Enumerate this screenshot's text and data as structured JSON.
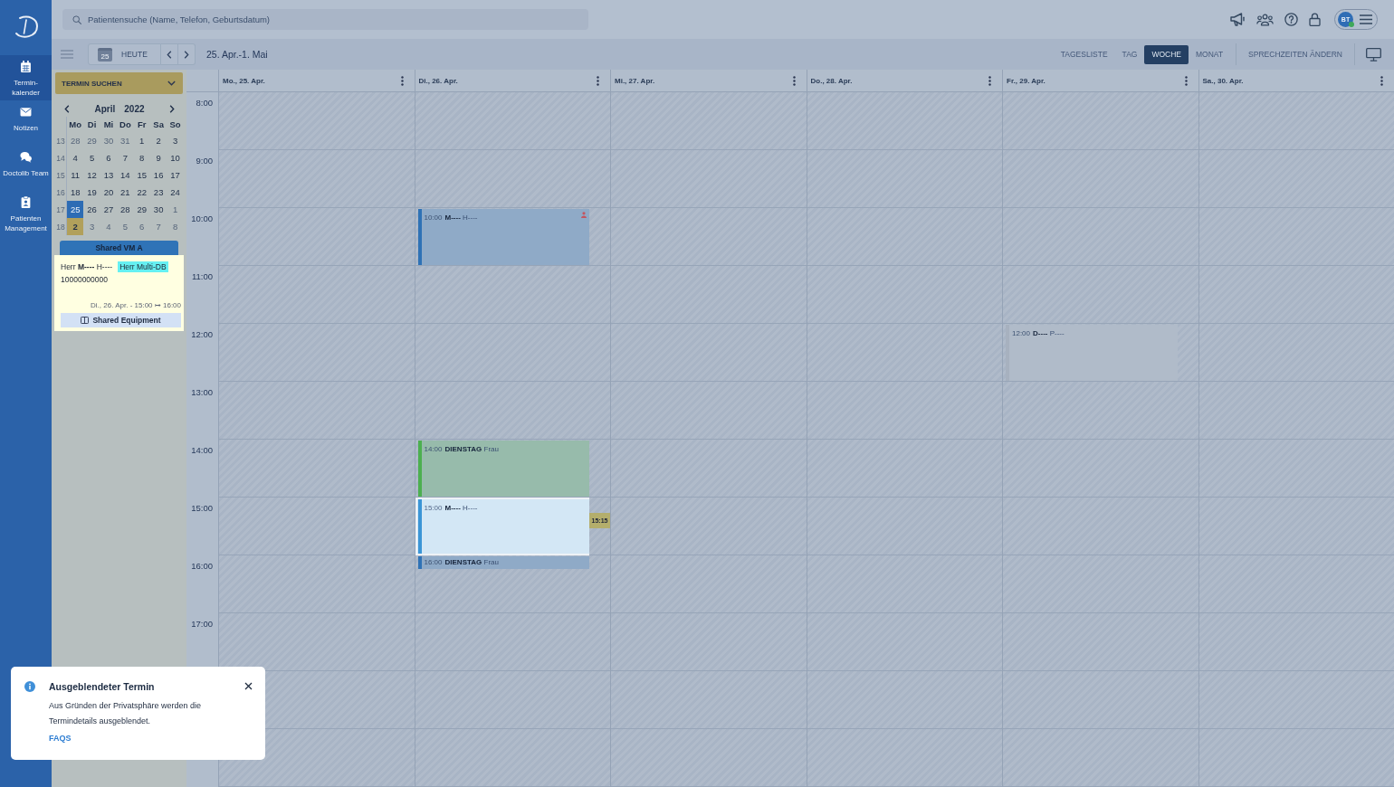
{
  "nav": {
    "items": [
      {
        "label": "Termin-kalender",
        "kind": "calendar",
        "selected": true
      },
      {
        "label": "Notizen",
        "kind": "mail",
        "selected": false
      },
      {
        "label": "Doctolib Team",
        "kind": "chat",
        "selected": false
      },
      {
        "label": "Patienten Management",
        "kind": "clipboard",
        "selected": false
      }
    ]
  },
  "search": {
    "placeholder": "Patientensuche (Name, Telefon, Geburtsdatum)"
  },
  "account": {
    "initials": "BT",
    "online": true
  },
  "toolbar": {
    "today_icon_label": "25",
    "today_button": "HEUTE",
    "date_range": "25. Apr.-1. Mai",
    "views": [
      {
        "label": "TAGESLISTE",
        "selected": false
      },
      {
        "label": "TAG",
        "selected": false
      },
      {
        "label": "WOCHE",
        "selected": true
      },
      {
        "label": "MONAT",
        "selected": false
      }
    ],
    "hours_button": "SPRECHZEITEN ÄNDERN"
  },
  "finder": {
    "label": "TERMIN SUCHEN"
  },
  "mini_calendar": {
    "month": "April",
    "year": "2022",
    "weekdays": [
      "Mo",
      "Di",
      "Mi",
      "Do",
      "Fr",
      "Sa",
      "So"
    ],
    "weeks": [
      {
        "number": "13",
        "days": [
          {
            "label": "28",
            "muted": true,
            "selected": false,
            "today": false
          },
          {
            "label": "29",
            "muted": true,
            "selected": false,
            "today": false
          },
          {
            "label": "30",
            "muted": true,
            "selected": false,
            "today": false
          },
          {
            "label": "31",
            "muted": true,
            "selected": false,
            "today": false
          },
          {
            "label": "1",
            "muted": false,
            "selected": false,
            "today": false
          },
          {
            "label": "2",
            "muted": false,
            "selected": false,
            "today": false
          },
          {
            "label": "3",
            "muted": false,
            "selected": false,
            "today": false
          }
        ]
      },
      {
        "number": "14",
        "days": [
          {
            "label": "4",
            "muted": false,
            "selected": false,
            "today": false
          },
          {
            "label": "5",
            "muted": false,
            "selected": false,
            "today": false
          },
          {
            "label": "6",
            "muted": false,
            "selected": false,
            "today": false
          },
          {
            "label": "7",
            "muted": false,
            "selected": false,
            "today": false
          },
          {
            "label": "8",
            "muted": false,
            "selected": false,
            "today": false
          },
          {
            "label": "9",
            "muted": false,
            "selected": false,
            "today": false
          },
          {
            "label": "10",
            "muted": false,
            "selected": false,
            "today": false
          }
        ]
      },
      {
        "number": "15",
        "days": [
          {
            "label": "11",
            "muted": false,
            "selected": false,
            "today": false
          },
          {
            "label": "12",
            "muted": false,
            "selected": false,
            "today": false
          },
          {
            "label": "13",
            "muted": false,
            "selected": false,
            "today": false
          },
          {
            "label": "14",
            "muted": false,
            "selected": false,
            "today": false
          },
          {
            "label": "15",
            "muted": false,
            "selected": false,
            "today": false
          },
          {
            "label": "16",
            "muted": false,
            "selected": false,
            "today": false
          },
          {
            "label": "17",
            "muted": false,
            "selected": false,
            "today": false
          }
        ]
      },
      {
        "number": "16",
        "days": [
          {
            "label": "18",
            "muted": false,
            "selected": false,
            "today": false
          },
          {
            "label": "19",
            "muted": false,
            "selected": false,
            "today": false
          },
          {
            "label": "20",
            "muted": false,
            "selected": false,
            "today": false
          },
          {
            "label": "21",
            "muted": false,
            "selected": false,
            "today": false
          },
          {
            "label": "22",
            "muted": false,
            "selected": false,
            "today": false
          },
          {
            "label": "23",
            "muted": false,
            "selected": false,
            "today": false
          },
          {
            "label": "24",
            "muted": false,
            "selected": false,
            "today": false
          }
        ]
      },
      {
        "number": "17",
        "days": [
          {
            "label": "25",
            "muted": false,
            "selected": true,
            "today": false
          },
          {
            "label": "26",
            "muted": false,
            "selected": false,
            "today": false
          },
          {
            "label": "27",
            "muted": false,
            "selected": false,
            "today": false
          },
          {
            "label": "28",
            "muted": false,
            "selected": false,
            "today": false
          },
          {
            "label": "29",
            "muted": false,
            "selected": false,
            "today": false
          },
          {
            "label": "30",
            "muted": false,
            "selected": false,
            "today": false
          },
          {
            "label": "1",
            "muted": true,
            "selected": false,
            "today": false
          }
        ]
      },
      {
        "number": "18",
        "days": [
          {
            "label": "2",
            "muted": false,
            "selected": false,
            "today": true
          },
          {
            "label": "3",
            "muted": true,
            "selected": false,
            "today": false
          },
          {
            "label": "4",
            "muted": true,
            "selected": false,
            "today": false
          },
          {
            "label": "5",
            "muted": true,
            "selected": false,
            "today": false
          },
          {
            "label": "6",
            "muted": true,
            "selected": false,
            "today": false
          },
          {
            "label": "7",
            "muted": true,
            "selected": false,
            "today": false
          },
          {
            "label": "8",
            "muted": true,
            "selected": false,
            "today": false
          }
        ]
      }
    ]
  },
  "popover": {
    "title": "Shared VM A",
    "patient": "Herr **M----** H----",
    "tag": "Herr Multi-DB",
    "phone": "10000000000",
    "when": "Di., 26. Apr. - 15:00 ↦ 16:00",
    "button": "Shared Equipment"
  },
  "calendar": {
    "hours": [
      "8:00",
      "9:00",
      "10:00",
      "11:00",
      "12:00",
      "13:00",
      "14:00",
      "15:00",
      "16:00",
      "17:00"
    ],
    "days": [
      {
        "label": "Mo., 25. Apr."
      },
      {
        "label": "Di., 26. Apr.",
        "appointments": [
          {
            "time": "10:00",
            "title": "**M----** H----",
            "kind": "regular",
            "color": "#2f72b5",
            "marked": true
          },
          {
            "time": "14:00",
            "title": "**DIENSTAG** Frau",
            "kind": "regular",
            "color": "#4caf50",
            "marked": false
          },
          {
            "time": "15:00",
            "title": "**M----** H----",
            "kind": "highlighted",
            "color": "#3b95d6",
            "marked": false
          },
          {
            "time": "16:00",
            "title": "**DIENSTAG** Frau",
            "kind": "brief",
            "color": "#2f72b5",
            "marked": false
          }
        ],
        "time_marker": "15:15"
      },
      {
        "label": "Mi., 27. Apr."
      },
      {
        "label": "Do., 28. Apr."
      },
      {
        "label": "Fr., 29. Apr.",
        "appointments": [
          {
            "time": "12:00",
            "title": "**D----** P----",
            "kind": "regular",
            "color": "#a7b1bf",
            "marked": false
          }
        ]
      },
      {
        "label": "Sa., 30. Apr."
      }
    ]
  },
  "toast": {
    "title": "Ausgeblendeter Termin",
    "text": "Aus Gründen der Privatsphäre werden die Termindetails ausgeblendet.",
    "link": "FAQS"
  }
}
